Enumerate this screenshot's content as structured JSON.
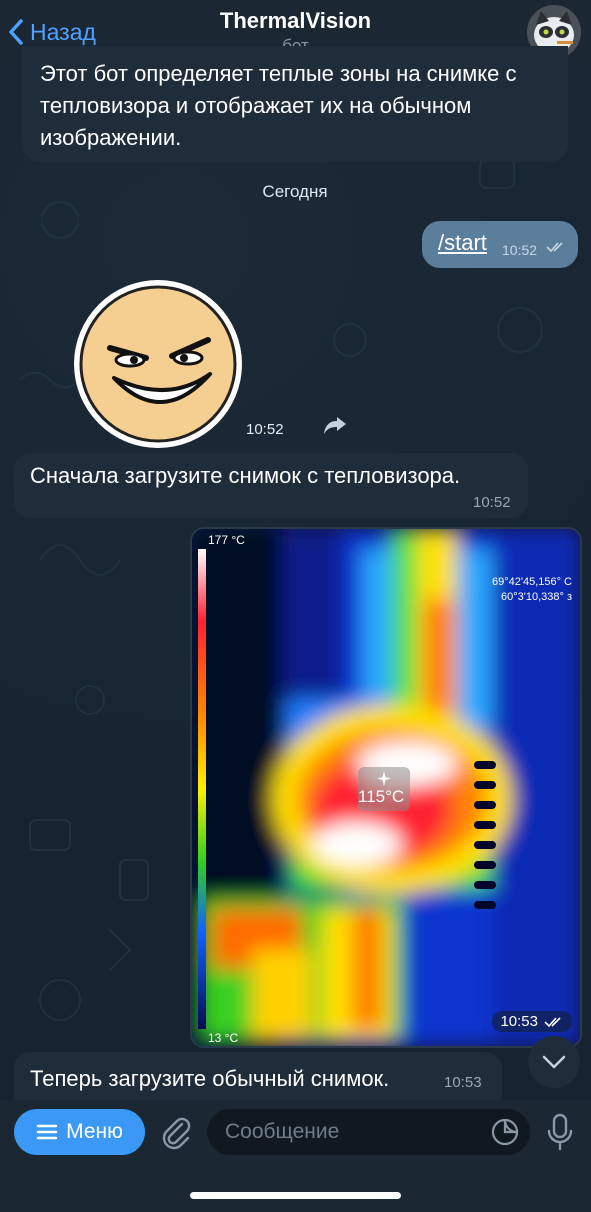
{
  "header": {
    "back_label": "Назад",
    "title": "ThermalVision",
    "subtitle": "бот"
  },
  "messages": {
    "intro_text": "Этот бот определяет теплые зоны на снимке с тепловизора и отображает их на обычном изображении.",
    "date_divider": "Сегодня",
    "start_command": "/start",
    "start_time": "10:52",
    "sticker_time": "10:52",
    "msg1_text": "Сначала загрузите снимок с тепловизора.",
    "msg1_time": "10:52",
    "photo": {
      "scale_max": "177 °C",
      "scale_min": "13 °C",
      "gps_line1": "69°42'45,156° С",
      "gps_line2": "60°3'10,338° з",
      "spot_temp": "115°C",
      "time": "10:53"
    },
    "msg2_text": "Теперь загрузите обычный снимок.",
    "msg2_time": "10:53"
  },
  "composer": {
    "menu_label": "Меню",
    "placeholder": "Сообщение"
  },
  "colors": {
    "accent": "#3b98f4",
    "outgoing_bubble": "#5b7e9c",
    "incoming_bubble": "#1f2c3a",
    "background": "#172331"
  }
}
